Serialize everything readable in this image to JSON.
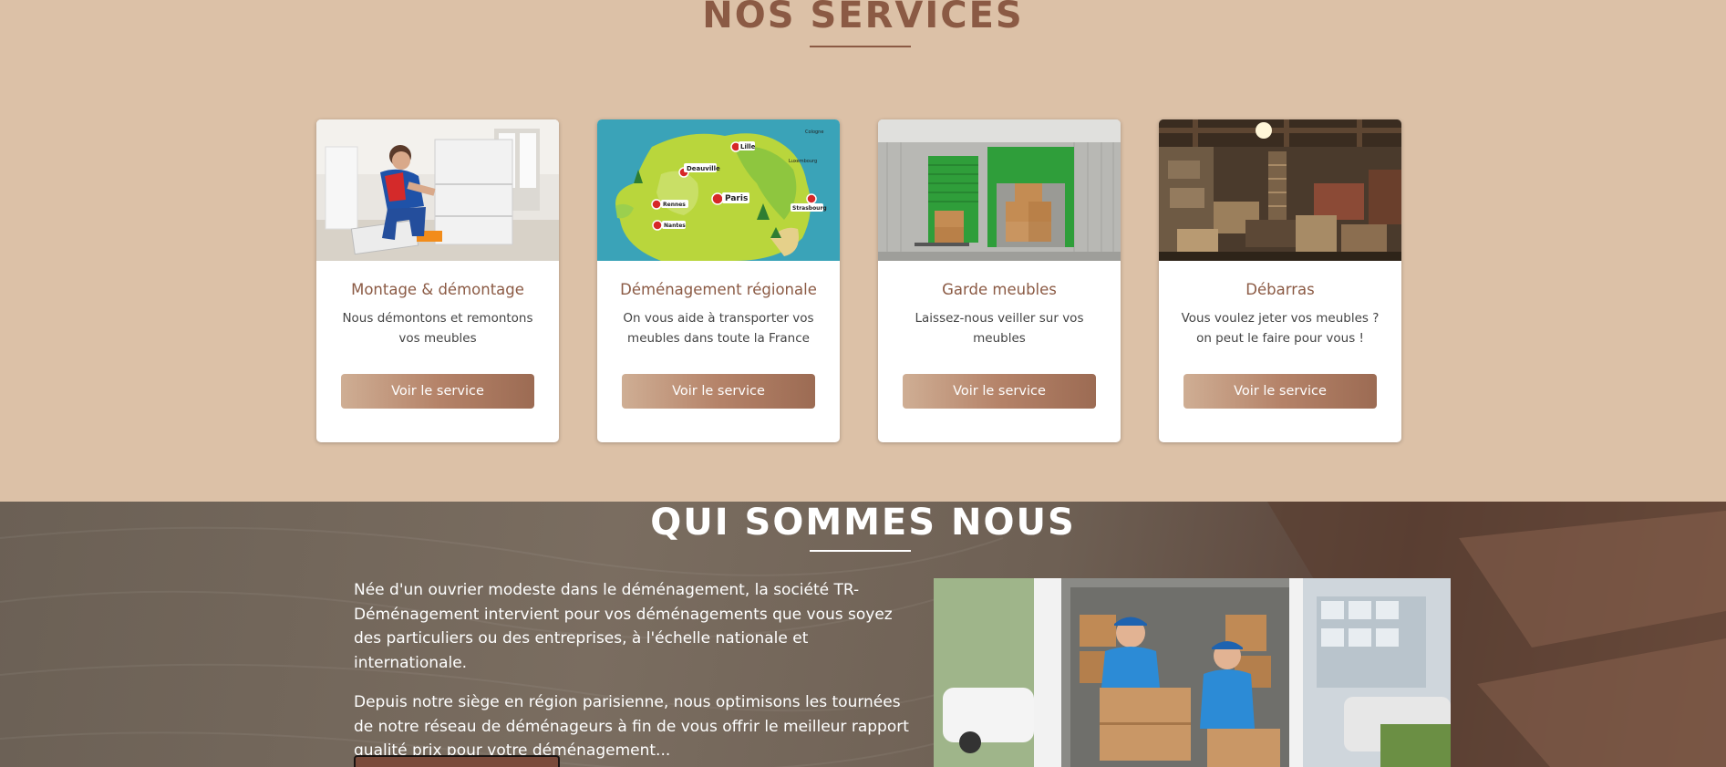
{
  "services": {
    "title": "NOS SERVICES",
    "cards": [
      {
        "title": "Montage & démontage",
        "desc": "Nous démontons et remontons vos meubles",
        "button": "Voir le service",
        "image": "furniture-assembly-photo"
      },
      {
        "title": "Déménagement régionale",
        "desc": "On vous aide à transporter vos meubles dans toute la France",
        "button": "Voir le service",
        "image": "france-map-illustration"
      },
      {
        "title": "Garde meubles",
        "desc": "Laissez-nous veiller sur vos meubles",
        "button": "Voir le service",
        "image": "storage-units-photo"
      },
      {
        "title": "Débarras",
        "desc": "Vous voulez jeter vos meubles ? on peut le faire pour vous !",
        "button": "Voir le service",
        "image": "cluttered-basement-photo"
      }
    ],
    "map_labels": [
      "Deauville",
      "Lille",
      "Paris",
      "Rennes",
      "Nantes",
      "Strasbourg",
      "Luxembourg",
      "Cologne"
    ]
  },
  "about": {
    "title": "QUI SOMMES NOUS",
    "paragraph1": "Née d'un ouvrier modeste dans le déménagement, la société TR-Déménagement intervient pour vos déménagements que vous soyez des particuliers ou des entreprises, à l'échelle nationale et internationale.",
    "paragraph2": "Depuis notre siège en région parisienne, nous optimisons les tournées de notre réseau de déménageurs à fin de vous offrir le meilleur rapport qualité prix pour votre déménagement...",
    "image": "movers-with-boxes-photo"
  },
  "colors": {
    "page_bg": "#dcc1a7",
    "accent": "#8b5a44",
    "button_gradient_start": "#cfae94",
    "button_gradient_end": "#9c6b53"
  }
}
